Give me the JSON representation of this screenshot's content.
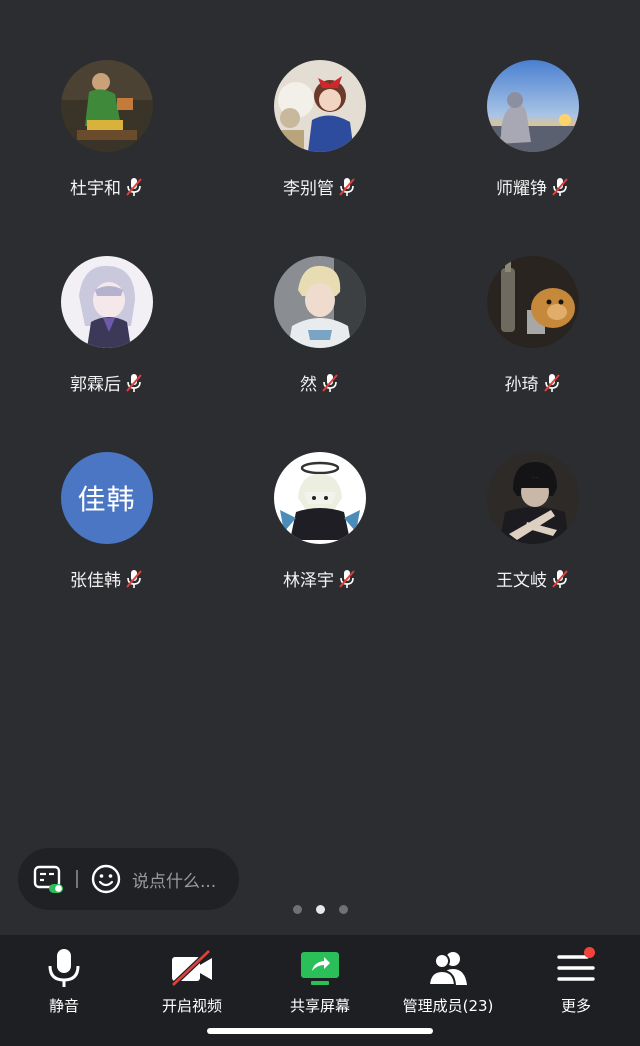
{
  "participants": [
    {
      "name": "杜宇和",
      "avatar": "photo-man-green-costume",
      "muted": true
    },
    {
      "name": "李别管",
      "avatar": "photo-girl-red-bow",
      "muted": true
    },
    {
      "name": "师耀铮",
      "avatar": "photo-sunset-beach",
      "muted": true
    },
    {
      "name": "郭霖后",
      "avatar": "anime-white-hair",
      "muted": true
    },
    {
      "name": "然",
      "avatar": "photo-boy-blond",
      "muted": true
    },
    {
      "name": "孙琦",
      "avatar": "photo-dog-bottles",
      "muted": true
    },
    {
      "name": "张佳韩",
      "avatar_text": "佳韩",
      "avatar_color": "#4a76c4",
      "muted": true
    },
    {
      "name": "林泽宇",
      "avatar": "anime-halo-chibi",
      "muted": true
    },
    {
      "name": "王文岐",
      "avatar": "anime-dark-hair-hand",
      "muted": true
    }
  ],
  "chat": {
    "placeholder": "说点什么..."
  },
  "pager": {
    "count": 3,
    "active": 2
  },
  "toolbar": {
    "mute_label": "静音",
    "video_label": "开启视频",
    "share_label": "共享屏幕",
    "members_label": "管理成员(23)",
    "more_label": "更多"
  },
  "colors": {
    "background": "#2b2d30",
    "toolbar": "#1e1f22",
    "share_green": "#2bbf5a",
    "muted_red": "#e0403a",
    "notification": "#f0443a"
  }
}
